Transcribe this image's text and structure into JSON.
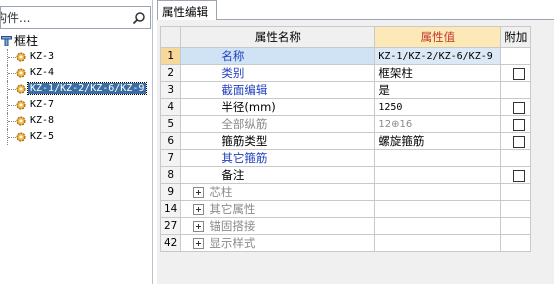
{
  "search": {
    "placeholder": "构件..."
  },
  "tree": {
    "root_label": "框柱",
    "nodes": [
      {
        "label": "KZ-3",
        "selected": false
      },
      {
        "label": "KZ-4",
        "selected": false
      },
      {
        "label": "KZ-1/KZ-2/KZ-6/KZ-9",
        "selected": true
      },
      {
        "label": "KZ-7",
        "selected": false
      },
      {
        "label": "KZ-8",
        "selected": false
      },
      {
        "label": "KZ-5",
        "selected": false
      }
    ]
  },
  "tabs": {
    "attr_edit": "属性编辑"
  },
  "grid": {
    "headers": {
      "name": "属性名称",
      "value": "属性值",
      "extra": "附加"
    },
    "rows": [
      {
        "idx": "1",
        "name": "名称",
        "value": "KZ-1/KZ-2/KZ-6/KZ-9",
        "checkbox": false
      },
      {
        "idx": "2",
        "name": "类别",
        "value": "框架柱",
        "checkbox": true
      },
      {
        "idx": "3",
        "name": "截面编辑",
        "value": "是",
        "checkbox": false
      },
      {
        "idx": "4",
        "name": "半径(mm)",
        "value": "1250",
        "checkbox": true
      },
      {
        "idx": "5",
        "name": "全部纵筋",
        "value": "12⊕16",
        "checkbox": true
      },
      {
        "idx": "6",
        "name": "箍筋类型",
        "value": "螺旋箍筋",
        "checkbox": true
      },
      {
        "idx": "7",
        "name": "其它箍筋",
        "value": "",
        "checkbox": false
      },
      {
        "idx": "8",
        "name": "备注",
        "value": "",
        "checkbox": true
      },
      {
        "idx": "9",
        "name": "芯柱",
        "value": "",
        "checkbox": false
      },
      {
        "idx": "14",
        "name": "其它属性",
        "value": "",
        "checkbox": false
      },
      {
        "idx": "27",
        "name": "锚固搭接",
        "value": "",
        "checkbox": false
      },
      {
        "idx": "42",
        "name": "显示样式",
        "value": "",
        "checkbox": false
      }
    ]
  },
  "icons": {
    "search": "search-icon",
    "tree_root": "column-tree-icon",
    "node": "component-gear-icon"
  },
  "colors": {
    "selection": "#3a6ea5",
    "value_header_bg": "#fde9b7",
    "value_header_text": "#c0392b",
    "blue_label": "#1f3fbf"
  }
}
